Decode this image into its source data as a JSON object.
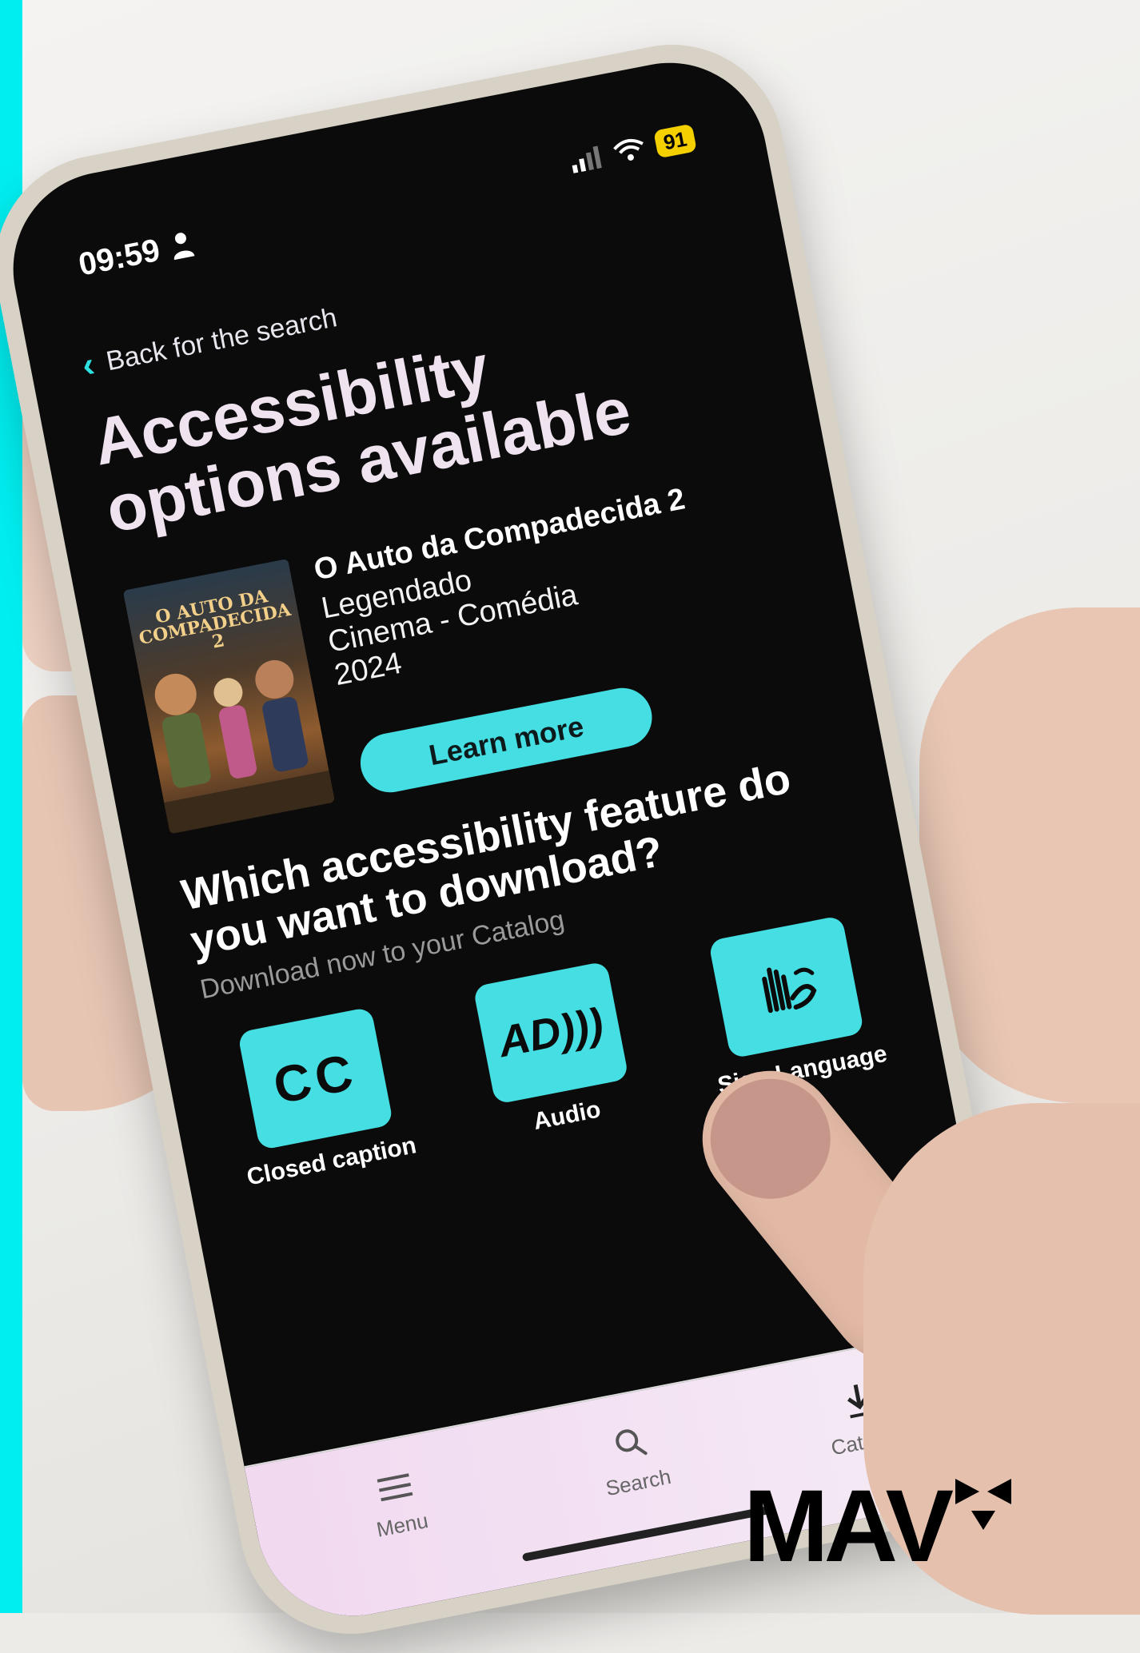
{
  "status_bar": {
    "time": "09:59",
    "battery": "91"
  },
  "nav": {
    "back_label": "Back for the search"
  },
  "header": {
    "title": "Accessibility options available"
  },
  "movie": {
    "poster_text": "O AUTO DA COMPADECIDA 2",
    "title": "O Auto da Compadecida 2",
    "subtitle_type": "Legendado",
    "genre": "Cinema - Comédia",
    "year": "2024",
    "learn_more_label": "Learn more"
  },
  "question": {
    "title": "Which accessibility feature do you want to download?",
    "subtitle": "Download now to your Catalog"
  },
  "features": [
    {
      "label": "Closed caption",
      "icon": "closed-caption-icon",
      "glyph": "CC"
    },
    {
      "label": "Audio",
      "icon": "audio-description-icon",
      "glyph": "AD)))"
    },
    {
      "label": "Sign Language",
      "icon": "sign-language-icon",
      "glyph": ""
    }
  ],
  "tabbar": {
    "menu": "Menu",
    "search": "Search",
    "catalog": "Catalog"
  },
  "brand": {
    "logo_text": "MAV"
  },
  "colors": {
    "accent": "#45dfe3",
    "strip": "#00eef0",
    "screen_bg": "#0b0b0b",
    "title_text": "#efe3f0"
  }
}
